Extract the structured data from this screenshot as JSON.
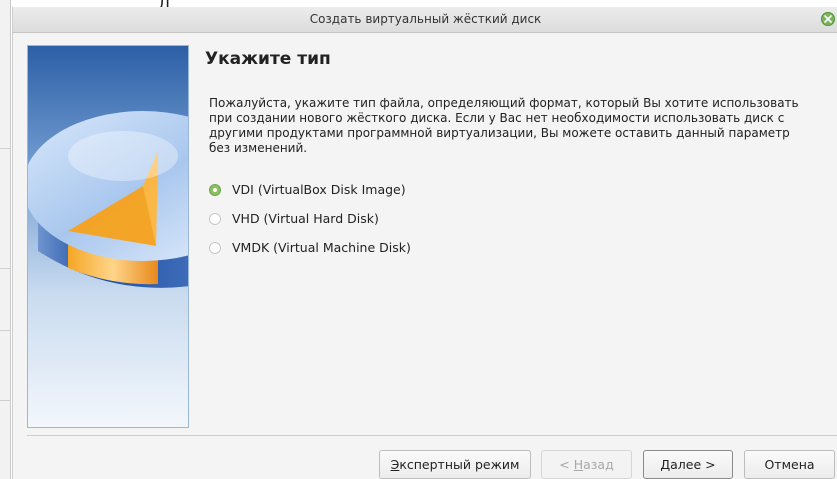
{
  "background": {
    "top_glyph": "Д"
  },
  "dialog": {
    "title": "Создать виртуальный жёсткий диск",
    "close_icon": "close-icon",
    "accent_color": "#8cc163"
  },
  "page": {
    "heading": "Укажите тип",
    "description": "Пожалуйста, укажите тип файла, определяющий формат, который Вы хотите использовать при создании нового жёсткого диска. Если у Вас нет необходимости использовать диск с другими продуктами программной виртуализации, Вы можете оставить данный параметр без изменений."
  },
  "disk_types": [
    {
      "label": "VDI (VirtualBox Disk Image)",
      "checked": true
    },
    {
      "label": "VHD (Virtual Hard Disk)",
      "checked": false
    },
    {
      "label": "VMDK (Virtual Machine Disk)",
      "checked": false
    }
  ],
  "buttons": {
    "expert_prefix": "Э",
    "expert_rest": "кспертный режим",
    "back_pre": "< ",
    "back_mnemonic": "Н",
    "back_rest": "азад",
    "next_mnemonic": "Д",
    "next_rest": "алее >",
    "cancel": "Отмена"
  }
}
